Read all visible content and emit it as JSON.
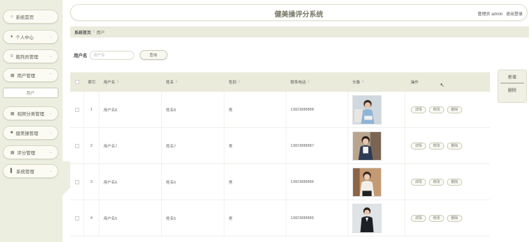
{
  "sidebar": {
    "items": [
      {
        "label": "系统首页",
        "icon": "home-icon"
      },
      {
        "label": "个人中心",
        "icon": "person-icon"
      },
      {
        "label": "裁判员管理",
        "icon": "list-icon"
      },
      {
        "label": "用户管理",
        "icon": "grid-icon"
      },
      {
        "label": "视频分类管理",
        "icon": "grid-icon"
      },
      {
        "label": "健美操管理",
        "icon": "trash-icon"
      },
      {
        "label": "评分管理",
        "icon": "grid-icon"
      },
      {
        "label": "系统管理",
        "icon": "bar-chart-icon"
      }
    ],
    "sub_item": "用户"
  },
  "header": {
    "title": "健美操评分系统",
    "admin_label": "管理员 admin",
    "logout_label": "退出登录"
  },
  "breadcrumb": {
    "home": "系统首页",
    "separator": "/",
    "current": "用户"
  },
  "search": {
    "label": "用户名",
    "placeholder": "用户名",
    "button": "查询"
  },
  "actions": {
    "add": "新增",
    "delete": "删除"
  },
  "table": {
    "headers": [
      "索引",
      "用户名",
      "姓名",
      "性别",
      "联系电话",
      "头像",
      "操作"
    ],
    "rows": [
      {
        "index": "1",
        "username": "用户名8",
        "name": "姓名8",
        "gender": "男",
        "phone": "13823888888"
      },
      {
        "index": "2",
        "username": "用户名7",
        "name": "姓名7",
        "gender": "男",
        "phone": "13823888887"
      },
      {
        "index": "3",
        "username": "用户名6",
        "name": "姓名6",
        "gender": "男",
        "phone": "13823888886"
      },
      {
        "index": "4",
        "username": "用户名5",
        "name": "姓名5",
        "gender": "男",
        "phone": "13823888885"
      }
    ],
    "row_actions": [
      "详情",
      "修改",
      "删除"
    ]
  }
}
